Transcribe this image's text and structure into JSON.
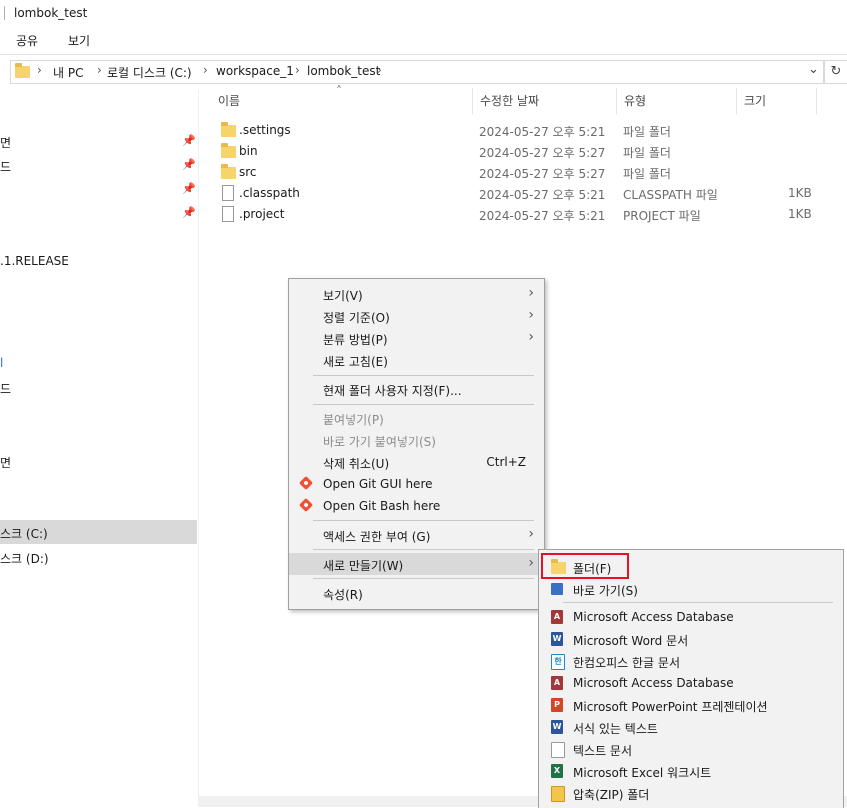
{
  "window": {
    "title": "lombok_test"
  },
  "ribbon": {
    "tabs": [
      "공유",
      "보기"
    ]
  },
  "address": {
    "crumbs": [
      "내 PC",
      "로컬 디스크 (C:)",
      "workspace_1",
      "lombok_test"
    ],
    "separator": "›",
    "dropdown": "⌄",
    "refresh": "↻"
  },
  "nav": {
    "items": [
      {
        "label": "면",
        "pinned": true
      },
      {
        "label": "드",
        "pinned": true
      },
      {
        "label": "",
        "pinned": true
      },
      {
        "label": "",
        "pinned": true
      },
      {
        "label": ".1.RELEASE"
      },
      {
        "label": "l"
      },
      {
        "label": "드"
      },
      {
        "label": "면"
      },
      {
        "label": "스크 (C:)",
        "selected": true
      },
      {
        "label": "스크 (D:)"
      }
    ],
    "pin_glyph": "📌"
  },
  "columns": {
    "name": "이름",
    "date": "수정한 날짜",
    "type": "유형",
    "size": "크기",
    "sort_glyph": "˄"
  },
  "files": [
    {
      "name": ".settings",
      "date": "2024-05-27 오후 5:21",
      "type": "파일 폴더",
      "size": "",
      "icon": "folder-icon"
    },
    {
      "name": "bin",
      "date": "2024-05-27 오후 5:27",
      "type": "파일 폴더",
      "size": "",
      "icon": "folder-icon"
    },
    {
      "name": "src",
      "date": "2024-05-27 오후 5:27",
      "type": "파일 폴더",
      "size": "",
      "icon": "folder-icon"
    },
    {
      "name": ".classpath",
      "date": "2024-05-27 오후 5:21",
      "type": "CLASSPATH 파일",
      "size": "1KB",
      "icon": "file-icon"
    },
    {
      "name": ".project",
      "date": "2024-05-27 오후 5:21",
      "type": "PROJECT 파일",
      "size": "1KB",
      "icon": "file-icon"
    }
  ],
  "context_menu": {
    "arrow": "›",
    "items": {
      "view": "보기(V)",
      "sort": "정렬 기준(O)",
      "group": "분류 방법(P)",
      "refresh": "새로 고침(E)",
      "customize": "현재 폴더 사용자 지정(F)...",
      "paste": "붙여넣기(P)",
      "paste_shortcut": "바로 가기 붙여넣기(S)",
      "undo_delete": "삭제 취소(U)",
      "undo_shortcut": "Ctrl+Z",
      "git_gui": "Open Git GUI here",
      "git_bash": "Open Git Bash here",
      "access": "액세스 권한 부여 (G)",
      "new": "새로 만들기(W)",
      "properties": "속성(R)"
    }
  },
  "submenu": {
    "items": [
      {
        "label": "폴더(F)",
        "icon": "folder-icon"
      },
      {
        "label": "바로 가기(S)",
        "icon": "shortcut-icon"
      },
      {
        "label": "Microsoft Access Database",
        "icon": "access-icon"
      },
      {
        "label": "Microsoft Word 문서",
        "icon": "word-icon"
      },
      {
        "label": "한컴오피스 한글 문서",
        "icon": "hwp-icon"
      },
      {
        "label": "Microsoft Access Database",
        "icon": "access-icon"
      },
      {
        "label": "Microsoft PowerPoint 프레젠테이션",
        "icon": "powerpoint-icon"
      },
      {
        "label": "서식 있는 텍스트",
        "icon": "rtf-icon"
      },
      {
        "label": "텍스트 문서",
        "icon": "text-doc-icon"
      },
      {
        "label": "Microsoft Excel 워크시트",
        "icon": "excel-icon"
      },
      {
        "label": "압축(ZIP) 폴더",
        "icon": "zip-icon"
      }
    ]
  },
  "colors": {
    "accent_highlight": "#e81123",
    "selection": "#d9d9d9",
    "folder": "#f6d36b"
  }
}
